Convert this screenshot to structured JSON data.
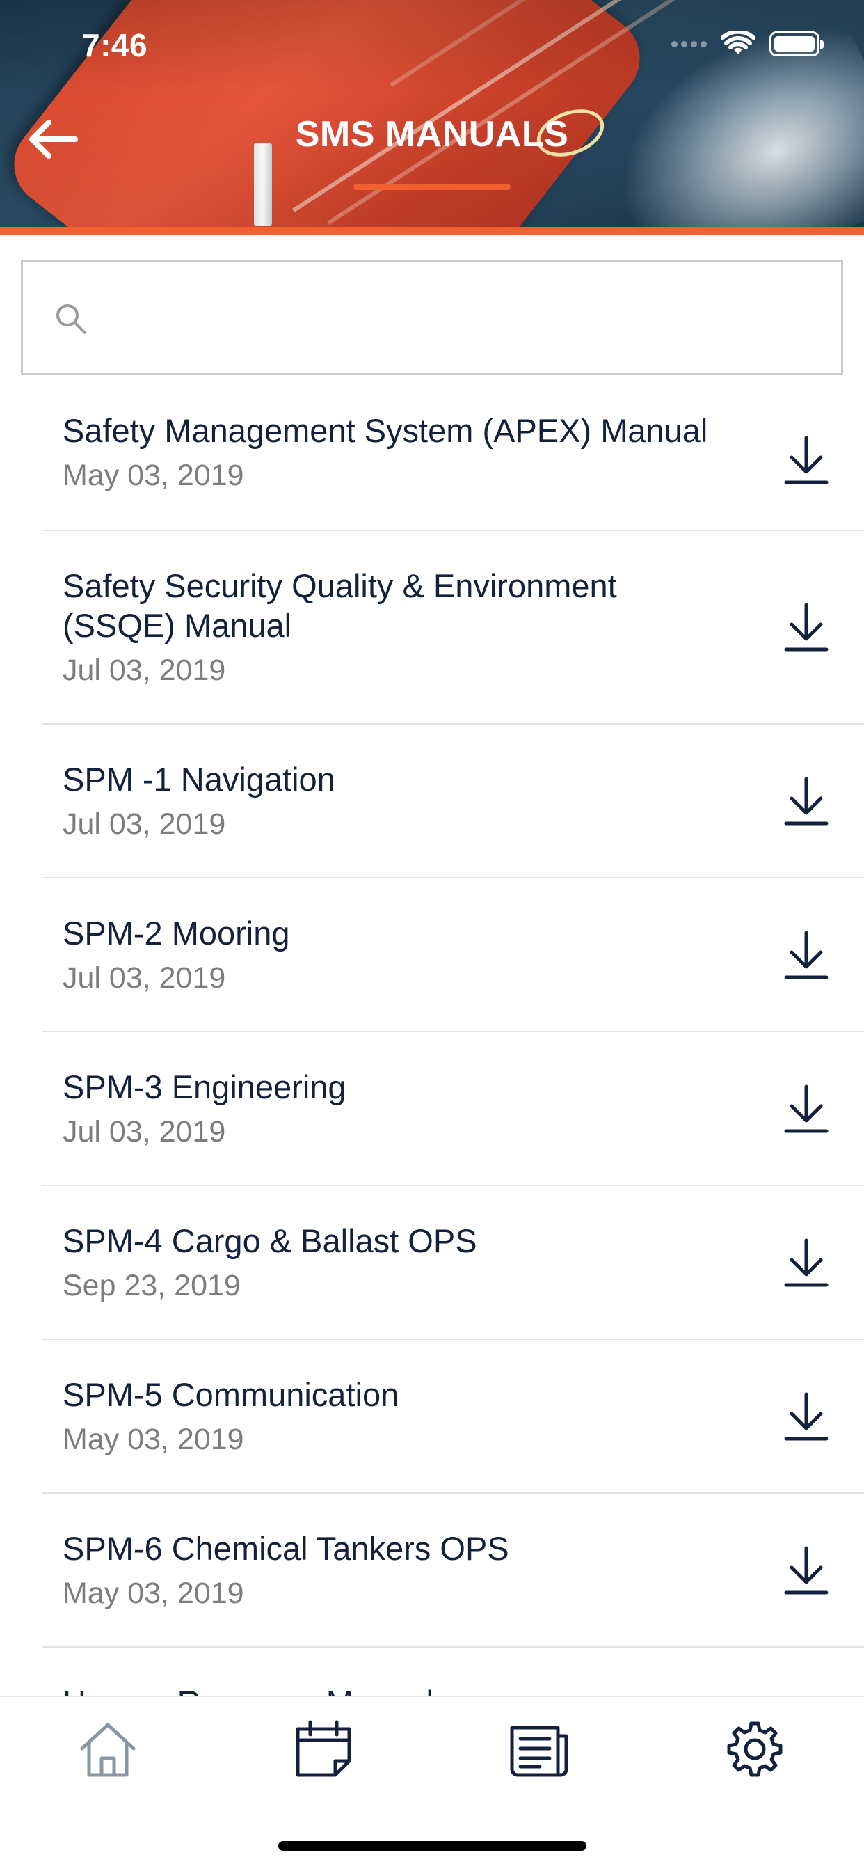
{
  "status_bar": {
    "time": "7:46"
  },
  "header": {
    "title": "SMS MANUALS",
    "back_icon": "arrow-left-icon"
  },
  "search": {
    "placeholder": "",
    "value": "",
    "icon": "search-icon"
  },
  "manuals": [
    {
      "title": "Safety Management System (APEX) Manual",
      "date": "May 03, 2019"
    },
    {
      "title": "Safety Security Quality & Environment (SSQE) Manual",
      "date": "Jul 03, 2019"
    },
    {
      "title": "SPM -1 Navigation",
      "date": "Jul 03, 2019"
    },
    {
      "title": "SPM-2 Mooring",
      "date": "Jul 03, 2019"
    },
    {
      "title": "SPM-3 Engineering",
      "date": "Jul 03, 2019"
    },
    {
      "title": "SPM-4 Cargo & Ballast OPS",
      "date": "Sep 23, 2019"
    },
    {
      "title": "SPM-5 Communication",
      "date": "May 03, 2019"
    },
    {
      "title": "SPM-6 Chemical Tankers OPS",
      "date": "May 03, 2019"
    },
    {
      "title": "Human Resource Manual",
      "date": ""
    }
  ],
  "tab_bar": {
    "tabs": [
      {
        "icon": "home-icon",
        "active": false
      },
      {
        "icon": "calendar-icon",
        "active": true
      },
      {
        "icon": "newspaper-icon",
        "active": true
      },
      {
        "icon": "gear-icon",
        "active": true
      }
    ]
  },
  "colors": {
    "accent": "#f0612f",
    "navy": "#14213d",
    "muted": "#7d7d7d",
    "inactive_tab": "#8a96a3"
  }
}
